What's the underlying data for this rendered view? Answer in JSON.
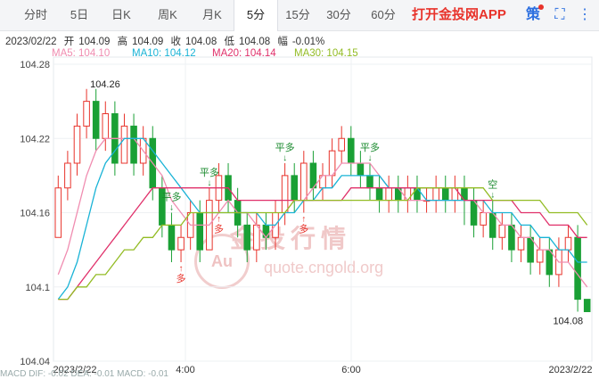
{
  "tabs": [
    {
      "label": "分时",
      "active": false
    },
    {
      "label": "5日",
      "active": false
    },
    {
      "label": "日K",
      "active": false
    },
    {
      "label": "周K",
      "active": false
    },
    {
      "label": "月K",
      "active": false
    },
    {
      "label": "5分",
      "active": true
    },
    {
      "label": "15分",
      "active": false
    },
    {
      "label": "30分",
      "active": false
    },
    {
      "label": "60分",
      "active": false
    }
  ],
  "brand": "打开金投网APP",
  "icons": {
    "strategy": "策",
    "fullscreen_icon": "⛶",
    "more_icon": "⋮"
  },
  "quote": {
    "date": "2023/02/22",
    "open_label": "开",
    "open": "104.09",
    "high_label": "高",
    "high": "104.09",
    "close_label": "收",
    "close": "104.08",
    "low_label": "低",
    "low": "104.08",
    "change_label": "幅",
    "change": "-0.01%"
  },
  "ma": [
    {
      "label": "MA5: 104.10",
      "color": "#f08cb0"
    },
    {
      "label": "MA10: 104.12",
      "color": "#19b3d6"
    },
    {
      "label": "MA20: 104.14",
      "color": "#e0306a"
    },
    {
      "label": "MA30: 104.15",
      "color": "#93bc24"
    }
  ],
  "watermark": {
    "text": "金投行情",
    "url": "quote.cngold.org",
    "logo": "Au"
  },
  "bottom_indicators": "MACD  DIF: -0.02   DEA: -0.01   MACD: -0.01",
  "chart_data": {
    "type": "candlestick",
    "y_ticks": [
      "104.28",
      "104.22",
      "104.16",
      "104.1",
      "104.04"
    ],
    "ylim": [
      104.04,
      104.28
    ],
    "x_ticks": [
      "2023/2/22",
      "4:00",
      "6:00",
      "2023/2/22"
    ],
    "high_label": "104.26",
    "low_label": "104.08",
    "colors": {
      "up": "#e8332b",
      "down": "#1aa035"
    },
    "candles": [
      [
        104.14,
        104.18,
        104.19,
        104.14
      ],
      [
        104.18,
        104.2,
        104.21,
        104.17
      ],
      [
        104.2,
        104.23,
        104.24,
        104.19
      ],
      [
        104.23,
        104.25,
        104.26,
        104.22
      ],
      [
        104.25,
        104.22,
        104.26,
        104.21
      ],
      [
        104.22,
        104.24,
        104.25,
        104.21
      ],
      [
        104.24,
        104.2,
        104.25,
        104.19
      ],
      [
        104.2,
        104.23,
        104.24,
        104.2
      ],
      [
        104.23,
        104.2,
        104.24,
        104.19
      ],
      [
        104.2,
        104.22,
        104.23,
        104.19
      ],
      [
        104.22,
        104.18,
        104.23,
        104.17
      ],
      [
        104.18,
        104.15,
        104.19,
        104.14
      ],
      [
        104.15,
        104.13,
        104.16,
        104.12
      ],
      [
        104.13,
        104.14,
        104.15,
        104.12
      ],
      [
        104.14,
        104.16,
        104.17,
        104.13
      ],
      [
        104.16,
        104.13,
        104.17,
        104.12
      ],
      [
        104.13,
        104.17,
        104.18,
        104.13
      ],
      [
        104.17,
        104.19,
        104.2,
        104.16
      ],
      [
        104.19,
        104.17,
        104.2,
        104.16
      ],
      [
        104.17,
        104.15,
        104.18,
        104.14
      ],
      [
        104.15,
        104.13,
        104.16,
        104.12
      ],
      [
        104.13,
        104.15,
        104.16,
        104.12
      ],
      [
        104.15,
        104.14,
        104.16,
        104.13
      ],
      [
        104.14,
        104.16,
        104.17,
        104.13
      ],
      [
        104.16,
        104.19,
        104.2,
        104.15
      ],
      [
        104.19,
        104.17,
        104.2,
        104.16
      ],
      [
        104.17,
        104.2,
        104.21,
        104.16
      ],
      [
        104.2,
        104.18,
        104.21,
        104.17
      ],
      [
        104.18,
        104.19,
        104.2,
        104.17
      ],
      [
        104.19,
        104.21,
        104.22,
        104.18
      ],
      [
        104.21,
        104.22,
        104.23,
        104.2
      ],
      [
        104.22,
        104.2,
        104.23,
        104.19
      ],
      [
        104.2,
        104.19,
        104.21,
        104.18
      ],
      [
        104.19,
        104.18,
        104.2,
        104.17
      ],
      [
        104.18,
        104.17,
        104.19,
        104.16
      ],
      [
        104.17,
        104.18,
        104.19,
        104.16
      ],
      [
        104.18,
        104.17,
        104.19,
        104.16
      ],
      [
        104.17,
        104.18,
        104.19,
        104.16
      ],
      [
        104.18,
        104.17,
        104.19,
        104.16
      ],
      [
        104.17,
        104.17,
        104.18,
        104.16
      ],
      [
        104.17,
        104.18,
        104.19,
        104.16
      ],
      [
        104.18,
        104.17,
        104.19,
        104.16
      ],
      [
        104.17,
        104.18,
        104.19,
        104.16
      ],
      [
        104.18,
        104.17,
        104.19,
        104.15
      ],
      [
        104.17,
        104.15,
        104.18,
        104.14
      ],
      [
        104.15,
        104.16,
        104.17,
        104.14
      ],
      [
        104.16,
        104.14,
        104.17,
        104.13
      ],
      [
        104.14,
        104.15,
        104.16,
        104.13
      ],
      [
        104.15,
        104.13,
        104.16,
        104.12
      ],
      [
        104.13,
        104.14,
        104.15,
        104.12
      ],
      [
        104.14,
        104.12,
        104.15,
        104.11
      ],
      [
        104.12,
        104.13,
        104.14,
        104.11
      ],
      [
        104.13,
        104.11,
        104.14,
        104.1
      ],
      [
        104.11,
        104.13,
        104.14,
        104.1
      ],
      [
        104.13,
        104.14,
        104.15,
        104.12
      ],
      [
        104.14,
        104.09,
        104.15,
        104.08
      ],
      [
        104.09,
        104.08,
        104.09,
        104.08
      ]
    ],
    "series": [
      {
        "name": "MA5",
        "color": "#f08cb0",
        "values": [
          104.11,
          104.13,
          104.16,
          104.19,
          104.21,
          104.22,
          104.22,
          104.22,
          104.22,
          104.21,
          104.2,
          104.19,
          104.17,
          104.16,
          104.15,
          104.15,
          104.15,
          104.16,
          104.17,
          104.16,
          104.16,
          104.15,
          104.14,
          104.15,
          104.16,
          104.17,
          104.17,
          104.18,
          104.19,
          104.19,
          104.2,
          104.2,
          104.2,
          104.2,
          104.19,
          104.18,
          104.18,
          104.17,
          104.17,
          104.17,
          104.17,
          104.17,
          104.17,
          104.17,
          104.17,
          104.16,
          104.16,
          104.15,
          104.15,
          104.14,
          104.14,
          104.13,
          104.13,
          104.12,
          104.12,
          104.11,
          104.1
        ]
      },
      {
        "name": "MA10",
        "color": "#19b3d6",
        "values": [
          104.09,
          104.1,
          104.12,
          104.15,
          104.18,
          104.2,
          104.21,
          104.22,
          104.22,
          104.22,
          104.21,
          104.2,
          104.19,
          104.18,
          104.17,
          104.16,
          104.16,
          104.16,
          104.16,
          104.16,
          104.16,
          104.16,
          104.15,
          104.15,
          104.16,
          104.16,
          104.17,
          104.17,
          104.18,
          104.18,
          104.19,
          104.19,
          104.19,
          104.19,
          104.19,
          104.18,
          104.18,
          104.18,
          104.18,
          104.17,
          104.17,
          104.17,
          104.17,
          104.17,
          104.17,
          104.17,
          104.16,
          104.16,
          104.16,
          104.15,
          104.15,
          104.14,
          104.14,
          104.13,
          104.13,
          104.12,
          104.12
        ]
      },
      {
        "name": "MA20",
        "color": "#e0306a",
        "values": [
          104.09,
          104.09,
          104.1,
          104.11,
          104.12,
          104.13,
          104.14,
          104.15,
          104.16,
          104.17,
          104.18,
          104.18,
          104.18,
          104.18,
          104.18,
          104.18,
          104.18,
          104.18,
          104.18,
          104.17,
          104.17,
          104.17,
          104.17,
          104.17,
          104.17,
          104.17,
          104.17,
          104.17,
          104.17,
          104.17,
          104.17,
          104.18,
          104.18,
          104.18,
          104.18,
          104.18,
          104.18,
          104.18,
          104.18,
          104.18,
          104.18,
          104.18,
          104.18,
          104.17,
          104.17,
          104.17,
          104.17,
          104.17,
          104.17,
          104.16,
          104.16,
          104.16,
          104.15,
          104.15,
          104.15,
          104.14,
          104.14
        ]
      },
      {
        "name": "MA30",
        "color": "#93bc24",
        "values": [
          104.09,
          104.09,
          104.1,
          104.1,
          104.11,
          104.11,
          104.12,
          104.13,
          104.13,
          104.14,
          104.14,
          104.15,
          104.15,
          104.15,
          104.16,
          104.16,
          104.16,
          104.16,
          104.16,
          104.16,
          104.16,
          104.16,
          104.16,
          104.16,
          104.16,
          104.17,
          104.17,
          104.17,
          104.17,
          104.17,
          104.17,
          104.17,
          104.17,
          104.17,
          104.17,
          104.17,
          104.17,
          104.17,
          104.18,
          104.18,
          104.18,
          104.18,
          104.18,
          104.18,
          104.18,
          104.18,
          104.17,
          104.17,
          104.17,
          104.17,
          104.17,
          104.17,
          104.16,
          104.16,
          104.16,
          104.16,
          104.15
        ]
      }
    ],
    "signals": [
      {
        "text": "平多",
        "index": 12
      },
      {
        "text": "平多",
        "index": 16
      },
      {
        "text": "平多",
        "index": 24
      },
      {
        "text": "平多",
        "index": 33
      },
      {
        "text": "空",
        "index": 46
      },
      {
        "text": "多",
        "index": 13
      },
      {
        "text": "多",
        "index": 17
      },
      {
        "text": "多",
        "index": 26
      }
    ]
  }
}
